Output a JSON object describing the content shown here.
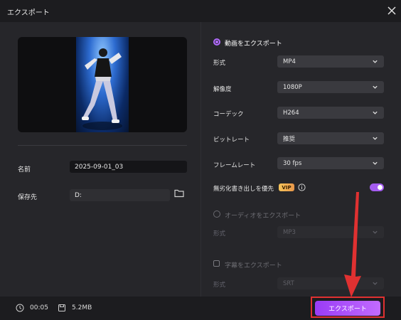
{
  "window": {
    "title": "エクスポート"
  },
  "icons": {
    "close": "close-icon",
    "folder": "folder-icon",
    "clock": "clock-icon",
    "disk": "disk-icon",
    "info": "info-icon",
    "chevron": "chevron-down-icon"
  },
  "colors": {
    "accent": "#a45cf0",
    "annotation": "#e03131",
    "vip": "#f0b34f"
  },
  "left": {
    "name_label": "名前",
    "name_value": "2025-09-01_03",
    "save_label": "保存先",
    "save_value": "D:"
  },
  "video": {
    "heading": "動画をエクスポート",
    "rows": [
      {
        "label": "形式",
        "value": "MP4"
      },
      {
        "label": "解像度",
        "value": "1080P"
      },
      {
        "label": "コーデック",
        "value": "H264"
      },
      {
        "label": "ビットレート",
        "value": "推奨"
      },
      {
        "label": "フレームレート",
        "value": "30 fps"
      }
    ],
    "priority_label": "無劣化書き出しを優先",
    "vip_badge": "VIP",
    "priority_enabled": true
  },
  "audio": {
    "heading": "オーディオをエクスポート",
    "format_label": "形式",
    "format_value": "MP3"
  },
  "subtitle": {
    "heading": "字幕をエクスポート",
    "format_label": "形式",
    "format_value": "SRT"
  },
  "footer": {
    "duration": "00:05",
    "size": "5.2MB",
    "export_button": "エクスポート"
  }
}
